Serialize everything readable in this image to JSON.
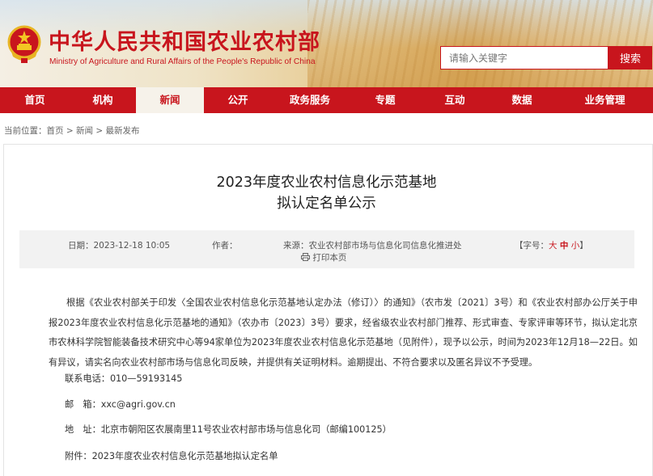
{
  "header": {
    "title": "中华人民共和国农业农村部",
    "subtitle": "Ministry of Agriculture and Rural Affairs of the People's Republic of China",
    "emblem_icon": "national-emblem-icon",
    "brand_color": "#c8151d"
  },
  "search": {
    "placeholder": "请输入关键字",
    "button_label": "搜索"
  },
  "nav": {
    "items": [
      {
        "label": "首页",
        "active": false
      },
      {
        "label": "机构",
        "active": false
      },
      {
        "label": "新闻",
        "active": true
      },
      {
        "label": "公开",
        "active": false
      },
      {
        "label": "政务服务",
        "active": false
      },
      {
        "label": "专题",
        "active": false
      },
      {
        "label": "互动",
        "active": false
      },
      {
        "label": "数据",
        "active": false
      },
      {
        "label": "业务管理",
        "active": false
      }
    ]
  },
  "breadcrumb": {
    "prefix": "当前位置：",
    "items": [
      "首页",
      "新闻",
      "最新发布"
    ],
    "separator": " > "
  },
  "article": {
    "title_line1": "2023年度农业农村信息化示范基地",
    "title_line2": "拟认定名单公示",
    "date": "日期：2023-12-18 10:05",
    "author": "作者：",
    "source": "来源：农业农村部市场与信息化司信息化推进处",
    "print_label": "打印本页",
    "print_icon": "printer-icon",
    "font_size_label": "【字号：",
    "font_size_large": "大",
    "font_size_medium": "中",
    "font_size_small": "小",
    "font_size_end": "】",
    "body": "根据《农业农村部关于印发〈全国农业农村信息化示范基地认定办法（修订）〉的通知》（农市发〔2021〕3号）和《农业农村部办公厅关于申报2023年度农业农村信息化示范基地的通知》（农办市〔2023〕3号）要求，经省级农业农村部门推荐、形式审查、专家评审等环节，拟认定北京市农林科学院智能装备技术研究中心等94家单位为2023年度农业农村信息化示范基地（见附件），现予以公示，时间为2023年12月18—22日。如有异议，请实名向农业农村部市场与信息化司反映，并提供有关证明材料。逾期提出、不符合要求以及匿名异议不予受理。",
    "phone": "联系电话：010—59193145",
    "email": "邮　箱：xxc@agri.gov.cn",
    "address": "地　址：北京市朝阳区农展南里11号农业农村部市场与信息化司（邮编100125）",
    "attachment": "附件：2023年度农业农村信息化示范基地拟认定名单"
  }
}
